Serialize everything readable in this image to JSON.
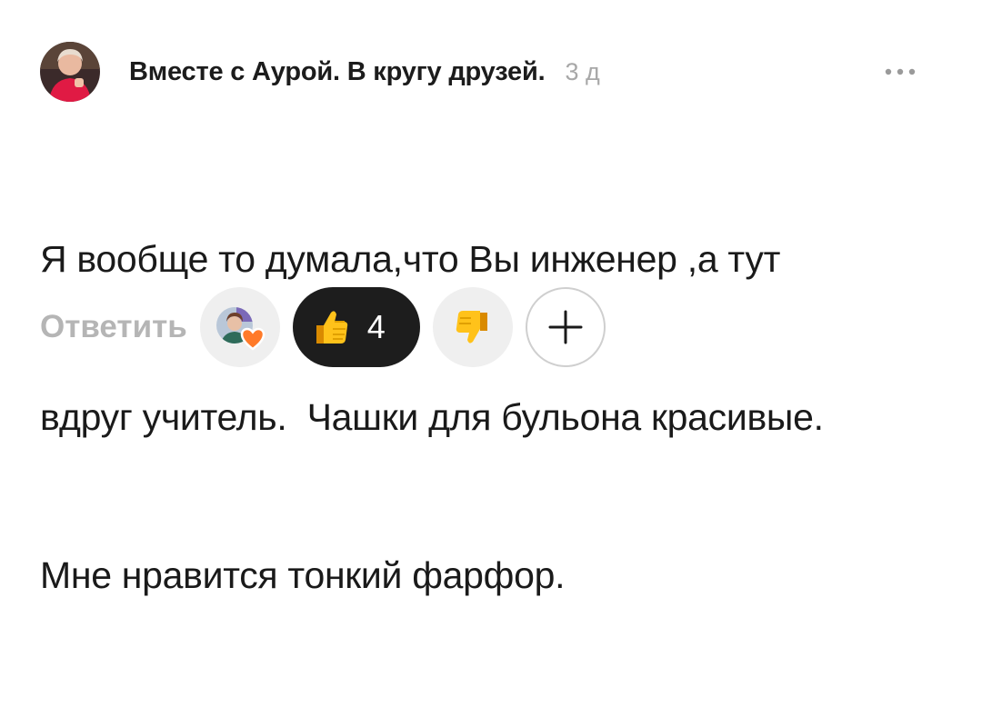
{
  "comment": {
    "author": "Вместе с Аурой. В кругу друзей.",
    "time": "3 д",
    "text_lines": [
      "Я вообще то думала,что Вы инженер ,а тут",
      "вдруг учитель.  Чашки для бульона красивые.",
      "Мне нравится тонкий фарфор."
    ]
  },
  "actions": {
    "reply_label": "Ответить",
    "like_count": "4"
  },
  "icons": {
    "more": "more-dots-icon",
    "like": "thumbs-up-emoji",
    "dislike": "thumbs-down-emoji",
    "add": "plus-icon",
    "reactor_heart": "heart-badge"
  },
  "colors": {
    "text": "#1a1a1a",
    "muted": "#a8a8a8",
    "like_pill": "#1d1d1d",
    "chip": "#efefef",
    "heart": "#ff7a29"
  }
}
